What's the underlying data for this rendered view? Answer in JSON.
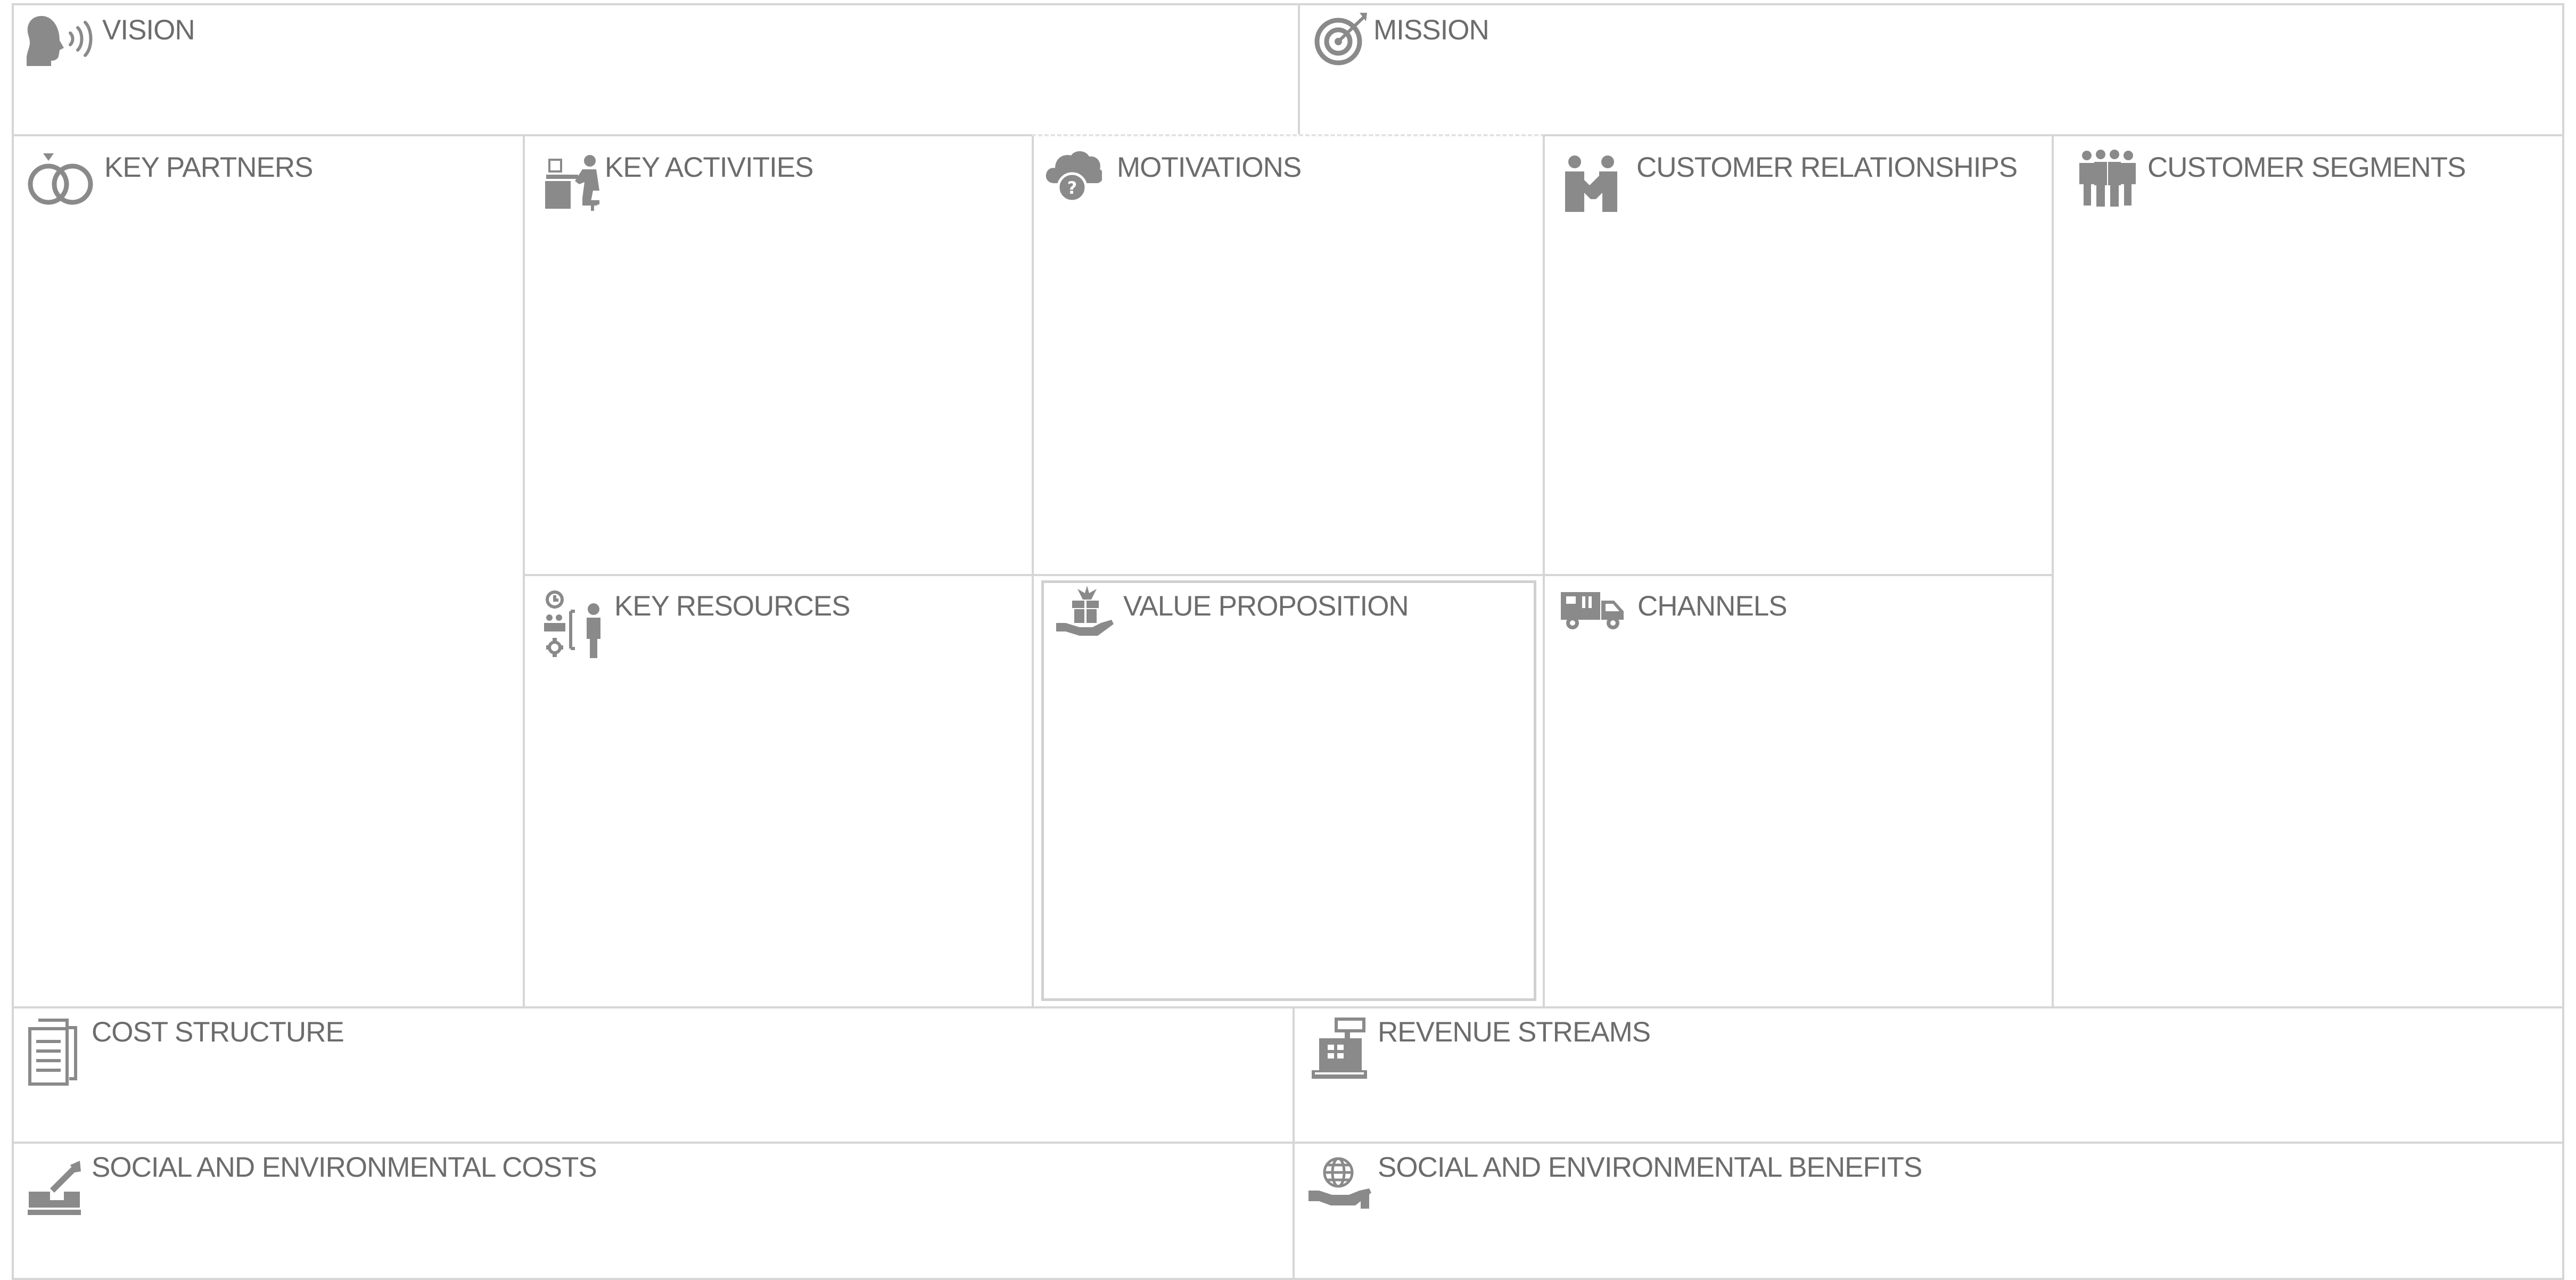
{
  "canvas": {
    "vision": {
      "title": "VISION",
      "icon": "speaking-head-icon"
    },
    "mission": {
      "title": "MISSION",
      "icon": "target-icon"
    },
    "key_partners": {
      "title": "KEY PARTNERS",
      "icon": "interlocking-rings-icon"
    },
    "key_activities": {
      "title": "KEY ACTIVITIES",
      "icon": "person-at-desk-icon"
    },
    "motivations": {
      "title": "MOTIVATIONS",
      "icon": "cloud-question-icon"
    },
    "customer_relationships": {
      "title": "CUSTOMER RELATIONSHIPS",
      "icon": "two-people-icon"
    },
    "customer_segments": {
      "title": "CUSTOMER SEGMENTS",
      "icon": "group-of-people-icon"
    },
    "key_resources": {
      "title": "KEY RESOURCES",
      "icon": "resources-org-icon"
    },
    "value_proposition": {
      "title": "VALUE PROPOSITION",
      "icon": "gift-in-hand-icon"
    },
    "channels": {
      "title": "CHANNELS",
      "icon": "delivery-truck-icon"
    },
    "cost_structure": {
      "title": "COST STRUCTURE",
      "icon": "document-icon"
    },
    "revenue_streams": {
      "title": "REVENUE STREAMS",
      "icon": "cash-register-icon"
    },
    "social_environmental_costs": {
      "title": "SOCIAL AND ENVIRONMENTAL COSTS",
      "icon": "excavator-icon"
    },
    "social_environmental_benefits": {
      "title": "SOCIAL AND ENVIRONMENTAL BENEFITS",
      "icon": "globe-in-hand-icon"
    }
  },
  "colors": {
    "border": "#d6d6d6",
    "icon": "#8a8a8a",
    "text": "#6c6c6c"
  }
}
